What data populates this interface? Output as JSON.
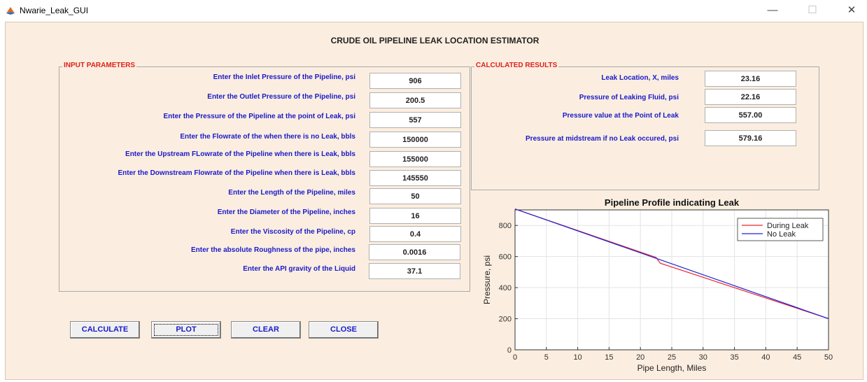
{
  "window": {
    "title": "Nwarie_Leak_GUI",
    "controls": {
      "minimize": "—",
      "maximize": "☐",
      "close": "✕"
    }
  },
  "main_title": "CRUDE OIL PIPELINE LEAK LOCATION ESTIMATOR",
  "input_panel": {
    "title": "INPUT PARAMETERS",
    "rows": [
      {
        "label": "Enter the Inlet Pressure of the Pipeline, psi",
        "value": "906"
      },
      {
        "label": "Enter the Outlet Pressure of the Pipeline, psi",
        "value": "200.5"
      },
      {
        "label": "Enter the Pressure of the Pipeline at the point of Leak, psi",
        "value": "557"
      },
      {
        "label": "Enter the Flowrate of the when there is no Leak, bbls",
        "value": "150000"
      },
      {
        "label": "Enter the Upstream FLowrate of the Pipeline when there is Leak, bbls",
        "value": "155000"
      },
      {
        "label": "Enter the Downstream Flowrate of the Pipeline when there is Leak, bbls",
        "value": "145550"
      },
      {
        "label": "Enter the Length of the Pipeline, miles",
        "value": "50"
      },
      {
        "label": "Enter the Diameter of the Pipeline, inches",
        "value": "16"
      },
      {
        "label": "Enter the Viscosity of the Pipeline, cp",
        "value": "0.4"
      },
      {
        "label": "Enter the absolute Roughness of the pipe, inches",
        "value": "0.0016"
      },
      {
        "label": "Enter the API gravity of the Liquid",
        "value": "37.1"
      }
    ]
  },
  "results_panel": {
    "title": "CALCULATED RESULTS",
    "rows": [
      {
        "label": "Leak Location, X, miles",
        "value": "23.16"
      },
      {
        "label": "Pressure of Leaking Fluid, psi",
        "value": "22.16"
      },
      {
        "label": "Pressure value at the Point of Leak",
        "value": "557.00"
      },
      {
        "label": "Pressure at midstream if no Leak occured, psi",
        "value": "579.16"
      }
    ]
  },
  "buttons": {
    "calculate": "CALCULATE",
    "plot": "PLOT",
    "clear": "CLEAR",
    "close": "CLOSE"
  },
  "colors": {
    "background": "#fbeee0",
    "label_blue": "#1a1ac8",
    "panel_title_red": "#e0201b",
    "during_leak": "#e8272a",
    "no_leak": "#2323d6"
  },
  "chart_data": {
    "type": "line",
    "title": "Pipeline Profile indicating Leak",
    "xlabel": "Pipe Length, Miles",
    "ylabel": "Pressure, psi",
    "xlim": [
      0,
      50
    ],
    "ylim": [
      0,
      900
    ],
    "xticks": [
      0,
      5,
      10,
      15,
      20,
      25,
      30,
      35,
      40,
      45,
      50
    ],
    "yticks": [
      0,
      200,
      400,
      600,
      800
    ],
    "grid": true,
    "legend_position": "top-right",
    "series": [
      {
        "name": "During Leak",
        "x": [
          0,
          22.5,
          23.16,
          50
        ],
        "y": [
          906,
          594,
          557,
          200.5
        ]
      },
      {
        "name": "No Leak",
        "x": [
          0,
          50
        ],
        "y": [
          906,
          200.5
        ]
      }
    ]
  }
}
